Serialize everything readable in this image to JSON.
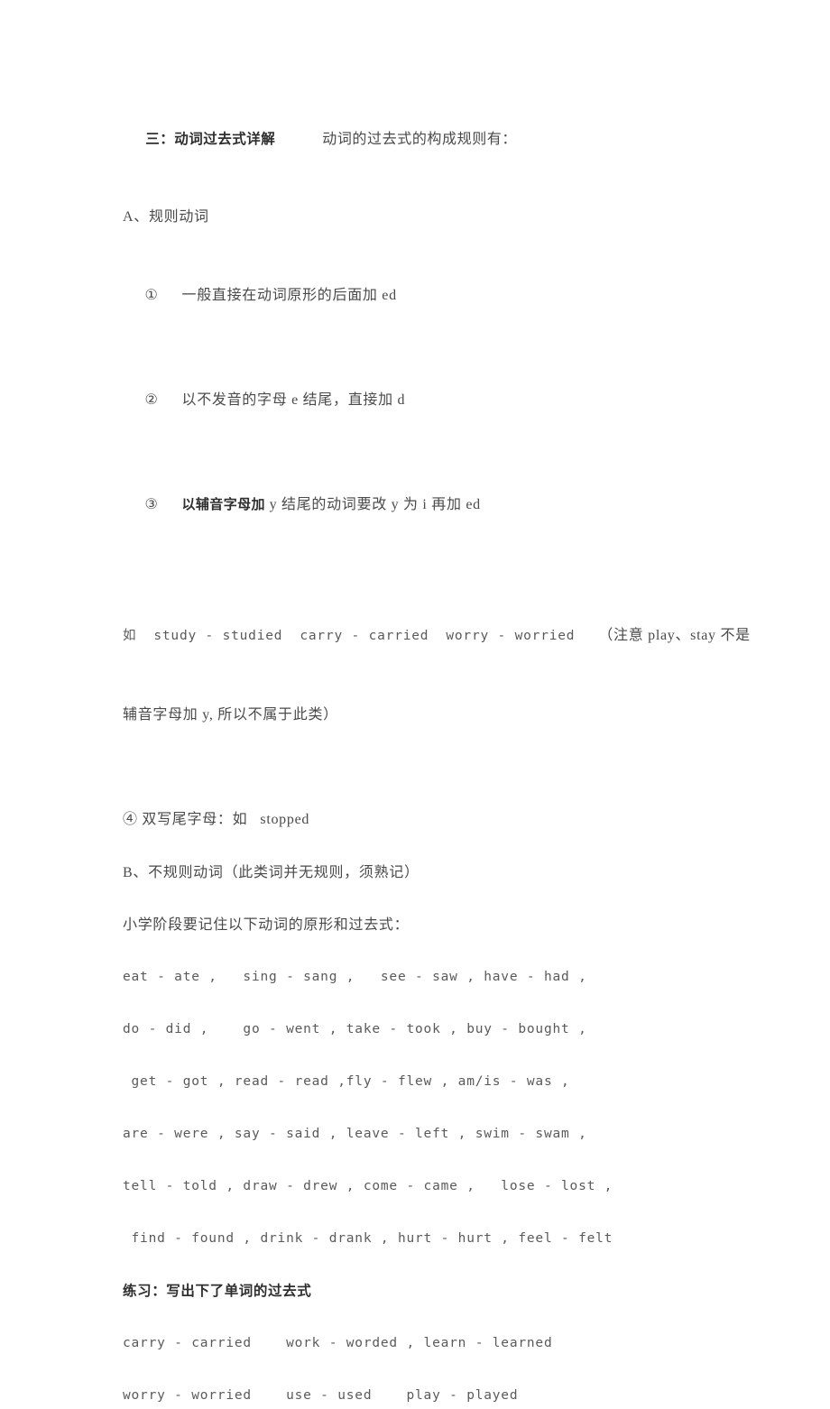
{
  "document": {
    "background_color": "#ffffff",
    "text_color": "#4a4a4a",
    "heading_color": "#2e2e2e",
    "mono_color": "#5a5a5a"
  },
  "heading": {
    "number_title": "三：动词过去式详解",
    "subtitle": "动词的过去式的构成规则有："
  },
  "section_a": {
    "label": "A、规则动词",
    "rules": [
      {
        "marker": "①",
        "text_before_bold": "",
        "bold": "",
        "text": "一般直接在动词原形的后面加 ed"
      },
      {
        "marker": "②",
        "text_before_bold": "",
        "bold": "",
        "text": "以不发音的字母 e 结尾，直接加 d"
      },
      {
        "marker": "③",
        "text_before_bold": "",
        "bold": "以辅音字母加",
        "text": " y 结尾的动词要改 y 为 i 再加 ed"
      }
    ],
    "example_line1_mono": "如  study - studied  carry - carried  worry - worried",
    "example_note_cjk": "（注意 play、stay 不是",
    "example_line2_cjk": "辅音字母加 y, 所以不属于此类）",
    "rule4": "④ 双写尾字母：如   stopped"
  },
  "section_b": {
    "label": "B、不规则动词（此类词并无规则，须熟记）",
    "intro": "小学阶段要记住以下动词的原形和过去式：",
    "verb_lines": [
      "eat - ate ,   sing - sang ,   see - saw , have - had ,",
      "do - did ,    go - went , take - took , buy - bought ,",
      " get - got , read - read ,fly - flew , am/is - was ,",
      "are - were , say - said , leave - left , swim - swam ,",
      "tell - told , draw - drew , come - came ,   lose - lost ,",
      " find - found , drink - drank , hurt - hurt , feel - felt"
    ]
  },
  "exercise": {
    "heading": "练习：写出下了单词的过去式",
    "lines": [
      "carry - carried    work - worded , learn - learned",
      "worry - worried    use - used    play - played"
    ]
  }
}
